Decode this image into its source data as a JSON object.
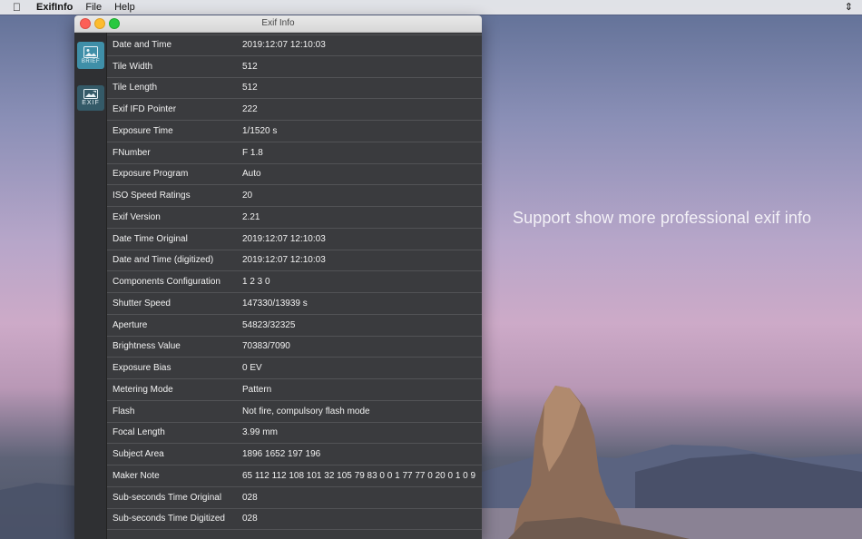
{
  "menubar": {
    "app_name": "ExifInfo",
    "menus": [
      "File",
      "Help"
    ]
  },
  "desktop": {
    "tagline": "Support show more professional exif info"
  },
  "window": {
    "title": "Exif Info",
    "sidebar": [
      {
        "name": "image-tab",
        "caption": "BRIEF",
        "active": true
      },
      {
        "name": "exif-tab",
        "caption": "EXIF",
        "active": false
      }
    ]
  },
  "rows": [
    {
      "key": "Date and Time",
      "value": "2019:12:07 12:10:03"
    },
    {
      "key": "Tile Width",
      "value": "512"
    },
    {
      "key": "Tile Length",
      "value": "512"
    },
    {
      "key": "Exif IFD Pointer",
      "value": "222"
    },
    {
      "key": "Exposure Time",
      "value": "1/1520 s"
    },
    {
      "key": "FNumber",
      "value": "F 1.8"
    },
    {
      "key": "Exposure Program",
      "value": "Auto"
    },
    {
      "key": "ISO Speed Ratings",
      "value": "20"
    },
    {
      "key": "Exif Version",
      "value": "2.21"
    },
    {
      "key": "Date Time Original",
      "value": "2019:12:07 12:10:03"
    },
    {
      "key": "Date and Time (digitized)",
      "value": "2019:12:07 12:10:03"
    },
    {
      "key": "Components Configuration",
      "value": "1 2 3 0"
    },
    {
      "key": "Shutter Speed",
      "value": "147330/13939 s"
    },
    {
      "key": "Aperture",
      "value": "54823/32325"
    },
    {
      "key": "Brightness Value",
      "value": "70383/7090"
    },
    {
      "key": "Exposure Bias",
      "value": "0 EV"
    },
    {
      "key": "Metering Mode",
      "value": "Pattern"
    },
    {
      "key": "Flash",
      "value": "Not fire, compulsory flash mode"
    },
    {
      "key": "Focal Length",
      "value": "3.99 mm"
    },
    {
      "key": "Subject Area",
      "value": "1896 1652 197 196"
    },
    {
      "key": "Maker Note",
      "value": "65 112 112 108 101 32 105 79 83 0 0 1 77 77 0 20 0 1 0 9"
    },
    {
      "key": "Sub-seconds Time Original",
      "value": "028"
    },
    {
      "key": "Sub-seconds Time Digitized",
      "value": "028"
    }
  ],
  "colors": {
    "sidebar_active": "#3f8fa8",
    "row_bg": "#3a3b3e",
    "text": "#f2f2f2"
  }
}
